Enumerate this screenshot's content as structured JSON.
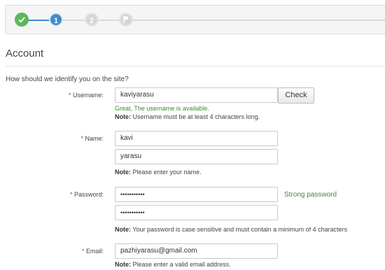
{
  "wizard": {
    "steps": [
      {
        "label": "",
        "state": "done",
        "icon": "check-icon"
      },
      {
        "label": "1",
        "state": "active"
      },
      {
        "label": "2",
        "state": "todo"
      },
      {
        "label": "",
        "state": "todo",
        "icon": "flag-icon"
      }
    ],
    "colors": {
      "done": "#5cb85c",
      "active": "#428bca",
      "todo": "#d5d5d5"
    }
  },
  "section": {
    "title": "Account",
    "intro": "How should we identify you on the site?"
  },
  "form": {
    "username": {
      "required_mark": "*",
      "label": "Username:",
      "value": "kaviyarasu",
      "check_label": "Check",
      "availability": "Great, The username is available.",
      "note_label": "Note:",
      "note": "Username must be at least 4 characters long."
    },
    "name": {
      "required_mark": "*",
      "label": "Name:",
      "first": "kavi",
      "last": "yarasu",
      "note_label": "Note:",
      "note": "Please enter your name."
    },
    "password": {
      "required_mark": "*",
      "label": "Password:",
      "value": "•••••••••••",
      "confirm": "•••••••••••",
      "strength": "Strong password",
      "note_label": "Note:",
      "note": "Your password is case sensitive and must contain a minimum of 4 characters"
    },
    "email": {
      "required_mark": "*",
      "label": "Email:",
      "value": "pazhiyarasu@gmail.com",
      "note_label": "Note:",
      "note": "Please enter a valid email address."
    }
  }
}
